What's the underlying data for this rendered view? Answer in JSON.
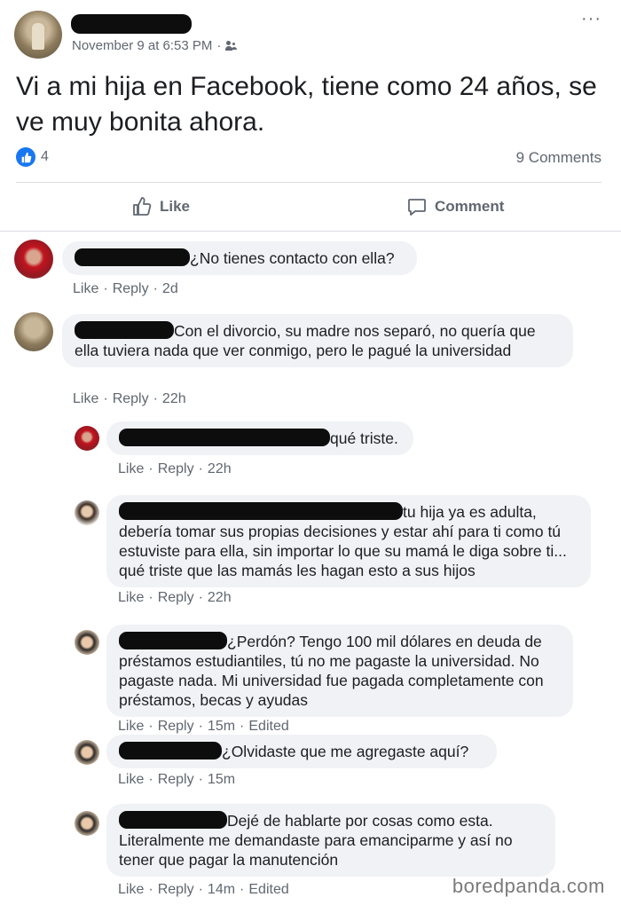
{
  "post": {
    "timestamp": "November 9 at 6:53 PM",
    "separator": "·",
    "audience_icon": "friends-icon",
    "text": "Vi a mi hija en Facebook, tiene como 24 años, se ve muy bonita ahora.",
    "like_count": "4",
    "comment_count": "9 Comments",
    "like_label": "Like",
    "comment_label": "Comment",
    "more_label": "···"
  },
  "comments": [
    {
      "text": "¿No tienes contacto con ella?",
      "like": "Like",
      "reply": "Reply",
      "time": "2d"
    },
    {
      "text": "Con el divorcio, su madre nos separó, no quería que ella tuviera nada que ver conmigo, pero le pagué la universidad",
      "like": "Like",
      "reply": "Reply",
      "time": "22h"
    },
    {
      "text": "qué triste.",
      "like": "Like",
      "reply": "Reply",
      "time": "22h"
    },
    {
      "text": "tu hija ya es adulta, debería tomar sus propias decisiones y estar ahí para ti como tú estuviste para ella, sin importar lo que su mamá le diga sobre ti... qué triste que las mamás les hagan esto a sus hijos",
      "like": "Like",
      "reply": "Reply",
      "time": "22h"
    },
    {
      "text": "¿Perdón? Tengo 100 mil dólares en deuda de préstamos estudiantiles, tú no me pagaste la universidad. No pagaste nada. Mi universidad fue pagada completamente con préstamos, becas y ayudas",
      "like": "Like",
      "reply": "Reply",
      "time": "15m",
      "edited": "Edited"
    },
    {
      "text": "¿Olvidaste que me agregaste aquí?",
      "like": "Like",
      "reply": "Reply",
      "time": "15m"
    },
    {
      "text": "Dejé de hablarte por cosas como esta. Literalmente me demandaste para emanciparme y así no tener que pagar la manutención",
      "like": "Like",
      "reply": "Reply",
      "time": "14m",
      "edited": "Edited"
    }
  ],
  "meta_separator": "·",
  "watermark": "boredpanda.com",
  "colors": {
    "like_blue": "#1877f2",
    "bubble_bg": "#f0f2f5",
    "meta_gray": "#606770"
  }
}
